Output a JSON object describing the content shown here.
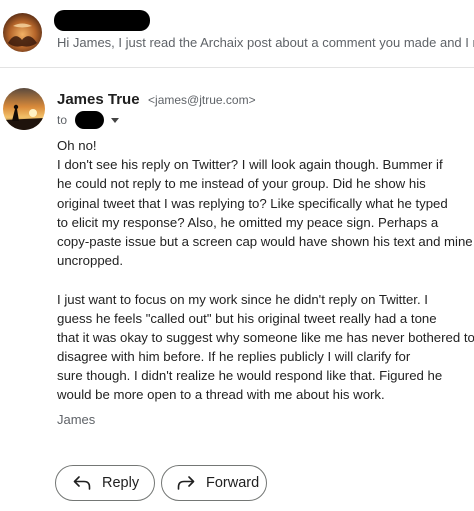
{
  "previous_message": {
    "sender_redacted": true,
    "snippet": "Hi James, I just read the Archaix post about a comment you made and I rea"
  },
  "message": {
    "sender_name": "James True",
    "sender_email": "<james@jtrue.com>",
    "to_label": "to",
    "recipient_redacted": true,
    "body_lines": [
      "Oh no!",
      "I don't see his reply on Twitter? I will look again though. Bummer if",
      "he could not reply to me instead of your group. Did he show his",
      "original tweet that I was replying to? Like specifically what he typed",
      "to elicit my response? Also, he omitted my peace sign. Perhaps a",
      "copy-paste issue but a screen cap would have shown his text and mine",
      "uncropped.",
      "",
      "I just want to focus on my work since he didn't reply on Twitter. I",
      "guess he feels \"called out\" but his original tweet really had a tone",
      "that it was okay to suggest why someone like me has never bothered to",
      "disagree with him before. If he replies publicly I will clarify for",
      "sure though. I didn't realize he would respond like that. Figured he",
      "would be more open to a thread with me about his work."
    ],
    "signature": "James"
  },
  "actions": {
    "reply_label": "Reply",
    "forward_label": "Forward",
    "reply_icon": "reply-arrow-icon",
    "forward_icon": "forward-arrow-icon"
  },
  "colors": {
    "redaction": "#000000",
    "divider": "#e3e3e3",
    "muted_text": "#5f6368",
    "button_border": "#747775"
  }
}
